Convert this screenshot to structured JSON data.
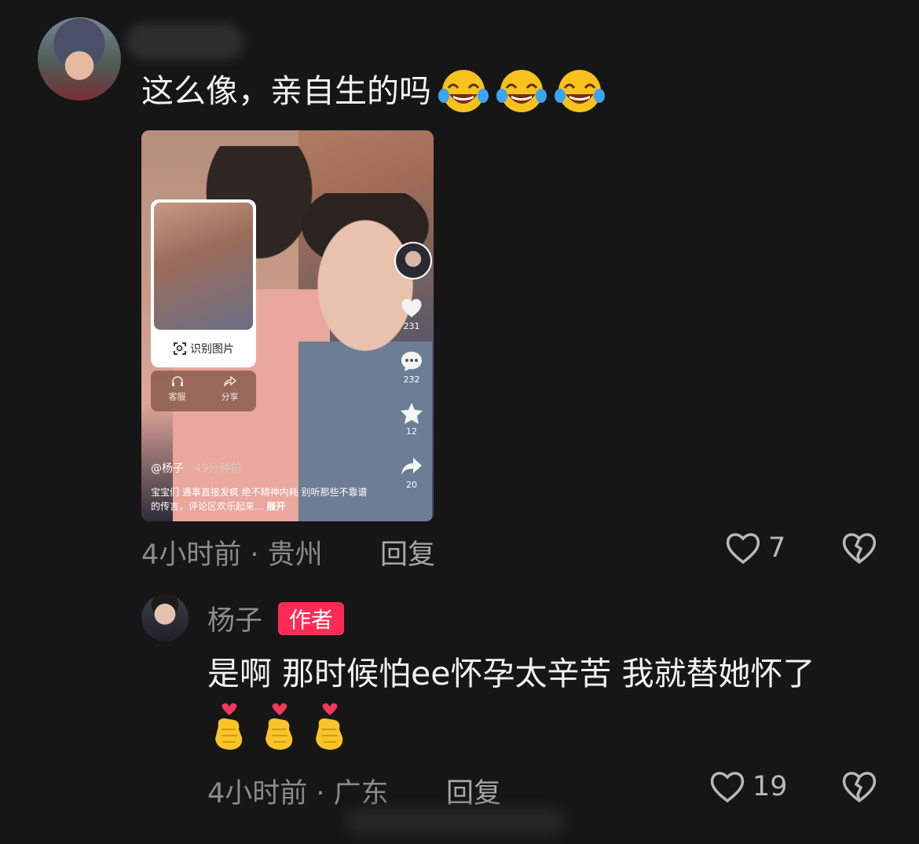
{
  "comments": [
    {
      "text": "这么像，亲自生的吗",
      "emojis": [
        "tears-of-joy",
        "tears-of-joy",
        "tears-of-joy"
      ],
      "meta": "4小时前 · 贵州",
      "reply_label": "回复",
      "like_count": "7",
      "attached_post": {
        "identify_label": "识别图片",
        "service_label": "客服",
        "share_label": "分享",
        "like_count": "231",
        "comment_count": "232",
        "favorite_count": "12",
        "share_count": "20",
        "handle": "@杨子",
        "time": "· 49分钟前",
        "description": "宝宝们 遇事直接发疯 绝不精神内耗 别听那些不靠谱的传言，评论区欢乐起来...",
        "expand_label": "展开"
      }
    },
    {
      "author": "杨子",
      "author_tag": "作者",
      "text": "是啊 那时候怕ee怀孕太辛苦 我就替她怀了",
      "emojis": [
        "finger-heart",
        "finger-heart",
        "finger-heart"
      ],
      "meta": "4小时前 · 广东",
      "reply_label": "回复",
      "like_count": "19"
    }
  ],
  "colors": {
    "background": "#161616",
    "author_tag": "#fe2c55",
    "meta_text": "#8b8b8b"
  }
}
